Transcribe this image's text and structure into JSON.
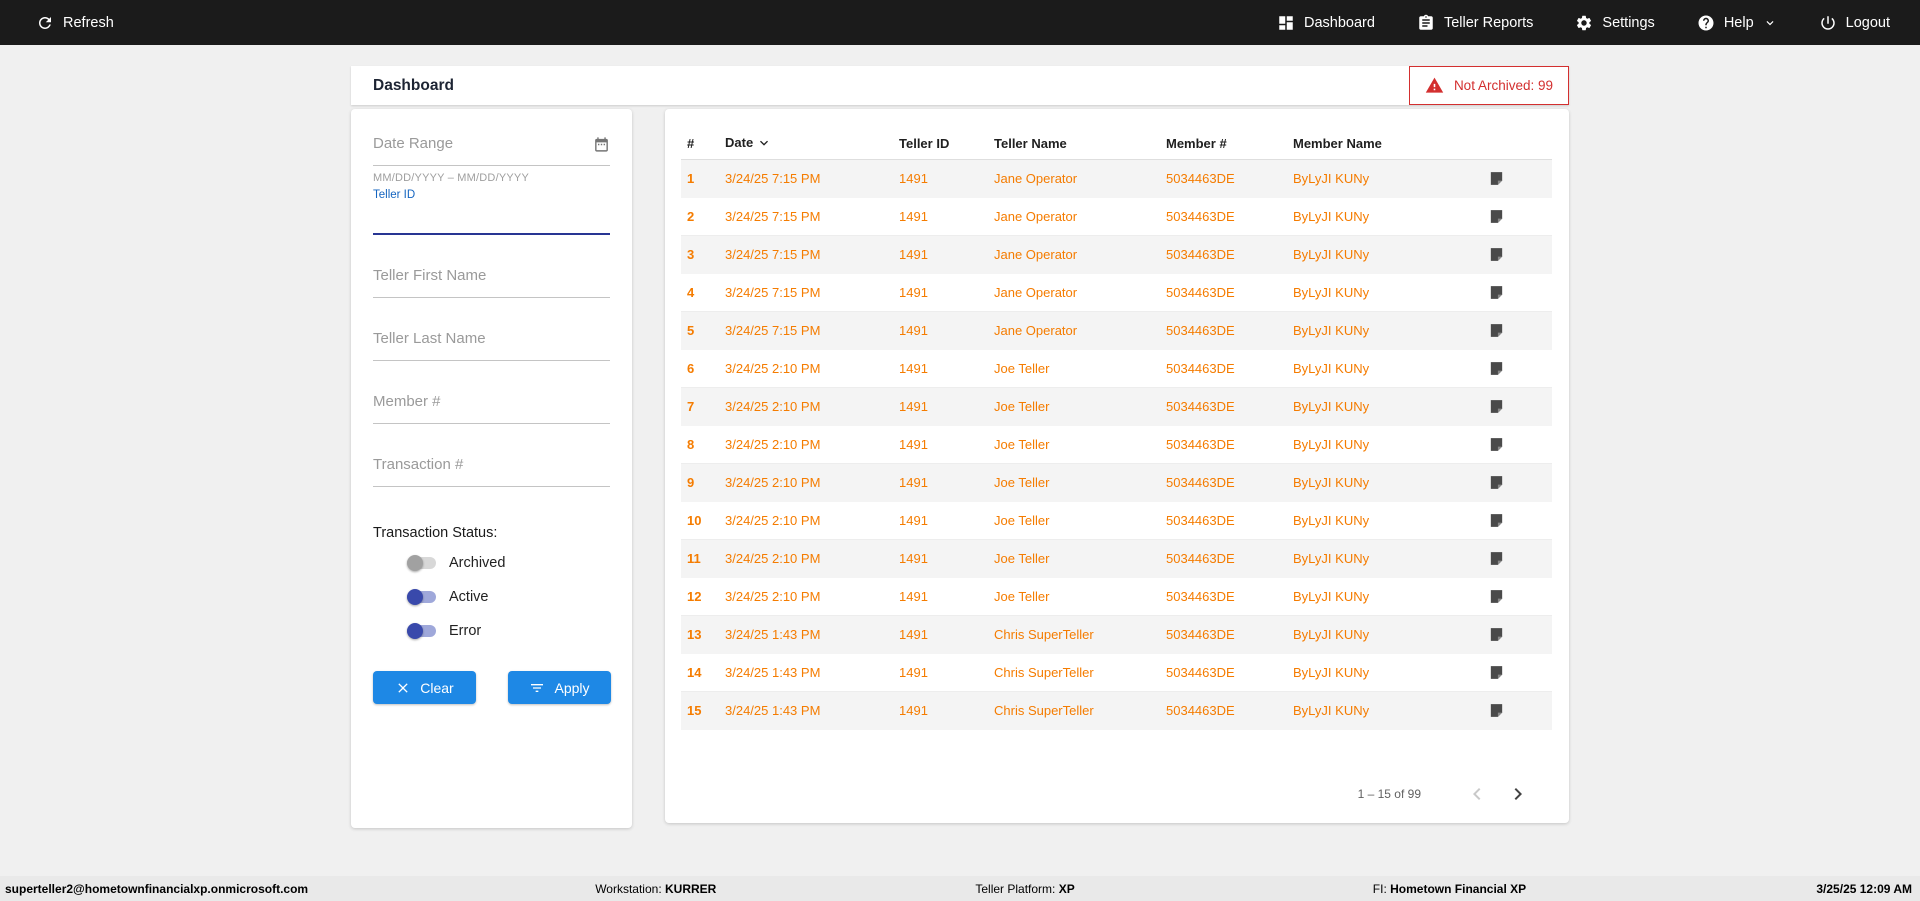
{
  "navbar": {
    "refresh_label": "Refresh",
    "dashboard_label": "Dashboard",
    "teller_reports_label": "Teller Reports",
    "settings_label": "Settings",
    "help_label": "Help",
    "logout_label": "Logout"
  },
  "header": {
    "title": "Dashboard",
    "not_archived_badge": "Not Archived: 99"
  },
  "filters": {
    "date_range_placeholder": "Date Range",
    "date_range_helper": "MM/DD/YYYY – MM/DD/YYYY",
    "teller_id_label": "Teller ID",
    "teller_first_name_placeholder": "Teller First Name",
    "teller_last_name_placeholder": "Teller Last Name",
    "member_number_placeholder": "Member #",
    "transaction_number_placeholder": "Transaction #",
    "transaction_status_label": "Transaction Status:",
    "toggles": [
      {
        "label": "Archived",
        "on": false
      },
      {
        "label": "Active",
        "on": true
      },
      {
        "label": "Error",
        "on": true
      }
    ],
    "clear_button": "Clear",
    "apply_button": "Apply"
  },
  "table": {
    "columns": [
      "#",
      "Date",
      "Teller ID",
      "Teller Name",
      "Member #",
      "Member Name"
    ],
    "rows": [
      {
        "num": "1",
        "date": "3/24/25 7:15 PM",
        "teller_id": "1491",
        "teller_name": "Jane Operator",
        "member_num": "5034463DE",
        "member_name": "ByLyJI KUNy"
      },
      {
        "num": "2",
        "date": "3/24/25 7:15 PM",
        "teller_id": "1491",
        "teller_name": "Jane Operator",
        "member_num": "5034463DE",
        "member_name": "ByLyJI KUNy"
      },
      {
        "num": "3",
        "date": "3/24/25 7:15 PM",
        "teller_id": "1491",
        "teller_name": "Jane Operator",
        "member_num": "5034463DE",
        "member_name": "ByLyJI KUNy"
      },
      {
        "num": "4",
        "date": "3/24/25 7:15 PM",
        "teller_id": "1491",
        "teller_name": "Jane Operator",
        "member_num": "5034463DE",
        "member_name": "ByLyJI KUNy"
      },
      {
        "num": "5",
        "date": "3/24/25 7:15 PM",
        "teller_id": "1491",
        "teller_name": "Jane Operator",
        "member_num": "5034463DE",
        "member_name": "ByLyJI KUNy"
      },
      {
        "num": "6",
        "date": "3/24/25 2:10 PM",
        "teller_id": "1491",
        "teller_name": "Joe Teller",
        "member_num": "5034463DE",
        "member_name": "ByLyJI KUNy"
      },
      {
        "num": "7",
        "date": "3/24/25 2:10 PM",
        "teller_id": "1491",
        "teller_name": "Joe Teller",
        "member_num": "5034463DE",
        "member_name": "ByLyJI KUNy"
      },
      {
        "num": "8",
        "date": "3/24/25 2:10 PM",
        "teller_id": "1491",
        "teller_name": "Joe Teller",
        "member_num": "5034463DE",
        "member_name": "ByLyJI KUNy"
      },
      {
        "num": "9",
        "date": "3/24/25 2:10 PM",
        "teller_id": "1491",
        "teller_name": "Joe Teller",
        "member_num": "5034463DE",
        "member_name": "ByLyJI KUNy"
      },
      {
        "num": "10",
        "date": "3/24/25 2:10 PM",
        "teller_id": "1491",
        "teller_name": "Joe Teller",
        "member_num": "5034463DE",
        "member_name": "ByLyJI KUNy"
      },
      {
        "num": "11",
        "date": "3/24/25 2:10 PM",
        "teller_id": "1491",
        "teller_name": "Joe Teller",
        "member_num": "5034463DE",
        "member_name": "ByLyJI KUNy"
      },
      {
        "num": "12",
        "date": "3/24/25 2:10 PM",
        "teller_id": "1491",
        "teller_name": "Joe Teller",
        "member_num": "5034463DE",
        "member_name": "ByLyJI KUNy"
      },
      {
        "num": "13",
        "date": "3/24/25 1:43 PM",
        "teller_id": "1491",
        "teller_name": "Chris SuperTeller",
        "member_num": "5034463DE",
        "member_name": "ByLyJI KUNy"
      },
      {
        "num": "14",
        "date": "3/24/25 1:43 PM",
        "teller_id": "1491",
        "teller_name": "Chris SuperTeller",
        "member_num": "5034463DE",
        "member_name": "ByLyJI KUNy"
      },
      {
        "num": "15",
        "date": "3/24/25 1:43 PM",
        "teller_id": "1491",
        "teller_name": "Chris SuperTeller",
        "member_num": "5034463DE",
        "member_name": "ByLyJI KUNy"
      }
    ],
    "pagination": {
      "range": "1 – 15 of 99"
    }
  },
  "footer": {
    "user": "superteller2@hometownfinancialxp.onmicrosoft.com",
    "workstation_label": "Workstation:",
    "workstation_value": "KURRER",
    "platform_label": "Teller Platform:",
    "platform_value": "XP",
    "fi_label": "FI:",
    "fi_value": "Hometown Financial XP",
    "datetime": "3/25/25 12:09 AM"
  },
  "colors": {
    "navbar_bg": "#1b1b1b",
    "accent_orange": "#f57c00",
    "primary_blue": "#1e88e5",
    "toggle_blue": "#3949ab",
    "alert_red": "#d32f2f"
  }
}
